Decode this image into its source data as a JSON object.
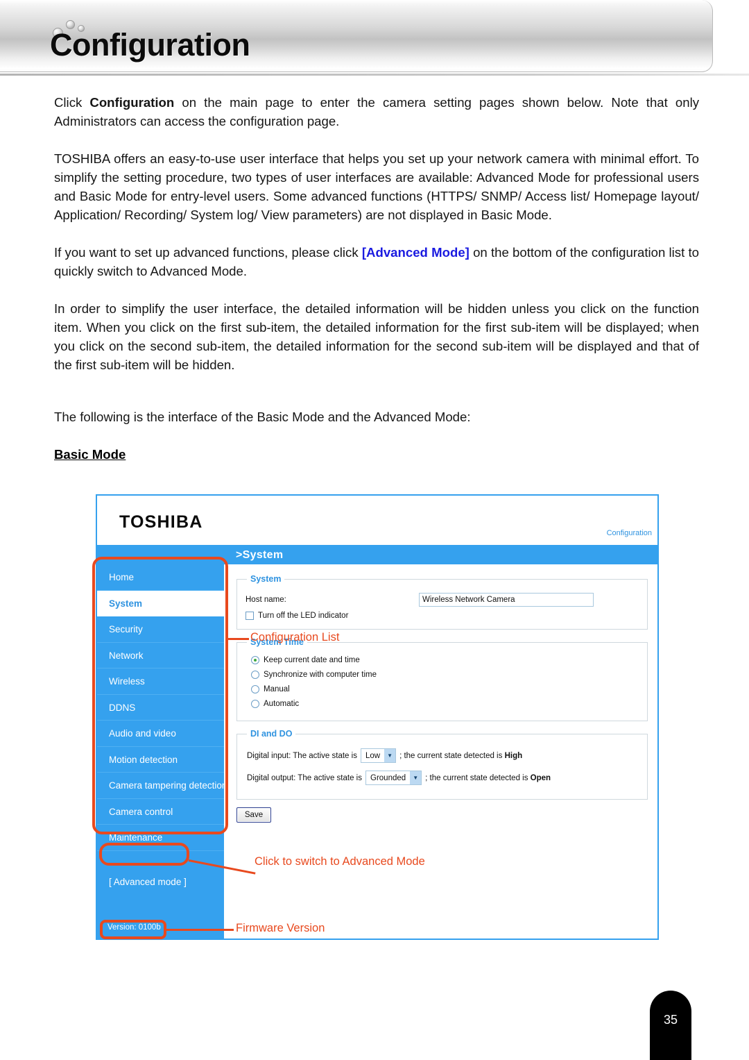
{
  "page": {
    "title": "Configuration",
    "number": "35"
  },
  "body": {
    "paragraphs": [
      {
        "id": "p1",
        "segments": [
          {
            "text": "Click ",
            "style": "normal"
          },
          {
            "text": "Configuration",
            "style": "bold"
          },
          {
            "text": " on the main page to enter the camera setting pages shown below. Note that only Administrators can access the configuration page.",
            "style": "normal"
          }
        ]
      },
      {
        "id": "p2",
        "segments": [
          {
            "text": "TOSHIBA offers an easy-to-use user interface that helps you set up your network camera with minimal effort. To simplify the setting procedure, two types of user interfaces are available: Advanced Mode for professional users and Basic Mode for entry-level users. Some advanced functions (HTTPS/ SNMP/ Access list/ Homepage layout/ Application/ Recording/ System log/ View parameters) are not displayed in Basic Mode.",
            "style": "normal"
          }
        ]
      },
      {
        "id": "p3",
        "segments": [
          {
            "text": "If you want to set up advanced functions, please click ",
            "style": "normal"
          },
          {
            "text": "[Advanced Mode]",
            "style": "link"
          },
          {
            "text": " on the bottom of the configuration list to quickly switch to Advanced Mode.",
            "style": "normal"
          }
        ]
      },
      {
        "id": "p4",
        "segments": [
          {
            "text": "In order to simplify the user interface, the detailed information will be hidden unless you click on the function item. When you click on the first sub-item, the detailed information for the first sub-item will be displayed; when you click on the second sub-item, the detailed information for the second sub-item will be displayed and that of the first sub-item will be hidden.",
            "style": "normal"
          }
        ]
      },
      {
        "id": "p5",
        "segments": [
          {
            "text": "The following is the interface of the Basic Mode and the Advanced Mode:",
            "style": "normal"
          }
        ]
      }
    ],
    "subheading": "Basic Mode"
  },
  "screenshot": {
    "brand": "TOSHIBA",
    "config_link": "Configuration",
    "breadcrumb": ">System",
    "sidebar": {
      "items": [
        {
          "label": "Home",
          "active": false
        },
        {
          "label": "System",
          "active": true
        },
        {
          "label": "Security",
          "active": false
        },
        {
          "label": "Network",
          "active": false
        },
        {
          "label": "Wireless",
          "active": false
        },
        {
          "label": "DDNS",
          "active": false
        },
        {
          "label": "Audio and video",
          "active": false
        },
        {
          "label": "Motion detection",
          "active": false
        },
        {
          "label": "Camera tampering detection",
          "active": false
        },
        {
          "label": "Camera control",
          "active": false
        },
        {
          "label": "Maintenance",
          "active": false
        }
      ],
      "advanced_mode": "[ Advanced mode ]",
      "version": "Version: 0100b"
    },
    "system_box": {
      "legend": "System",
      "host_name_label": "Host name:",
      "host_name_value": "Wireless Network Camera",
      "led_checkbox_label": "Turn off the LED indicator",
      "led_checkbox_checked": false
    },
    "system_time_box": {
      "legend": "System Time",
      "options": [
        {
          "label": "Keep current date and time",
          "selected": true
        },
        {
          "label": "Synchronize with computer time",
          "selected": false
        },
        {
          "label": "Manual",
          "selected": false
        },
        {
          "label": "Automatic",
          "selected": false
        }
      ]
    },
    "di_do_box": {
      "legend": "DI and DO",
      "digital_input": {
        "prefix": "Digital input: The active state is",
        "select_value": "Low",
        "suffix": "; the current state detected is",
        "state": "High"
      },
      "digital_output": {
        "prefix": "Digital output: The active state is",
        "select_value": "Grounded",
        "suffix": "; the current state detected is",
        "state": "Open"
      }
    },
    "save_button": "Save"
  },
  "annotations": [
    {
      "id": "configuration_list",
      "text": "Configuration List"
    },
    {
      "id": "advanced_mode_switch",
      "text": "Click to switch to Advanced Mode"
    },
    {
      "id": "firmware_version",
      "text": "Firmware Version"
    }
  ],
  "colors": {
    "accent_blue": "#35a1ee",
    "annotation_orange": "#e8491e",
    "link_blue": "#1a1ae0",
    "panel_border": "#cfd8de"
  }
}
